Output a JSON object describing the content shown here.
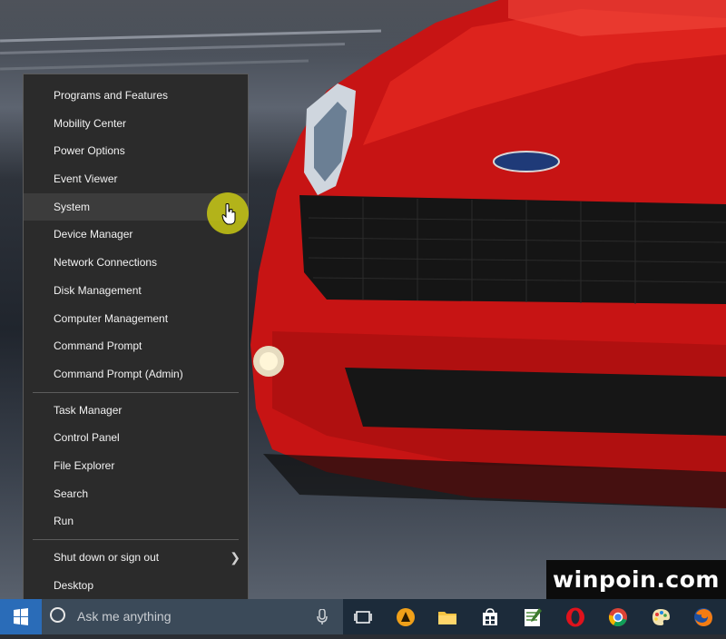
{
  "menu": {
    "group1": [
      {
        "label": "Programs and Features"
      },
      {
        "label": "Mobility Center"
      },
      {
        "label": "Power Options"
      },
      {
        "label": "Event Viewer"
      },
      {
        "label": "System"
      },
      {
        "label": "Device Manager"
      },
      {
        "label": "Network Connections"
      },
      {
        "label": "Disk Management"
      },
      {
        "label": "Computer Management"
      },
      {
        "label": "Command Prompt"
      },
      {
        "label": "Command Prompt (Admin)"
      }
    ],
    "group2": [
      {
        "label": "Task Manager"
      },
      {
        "label": "Control Panel"
      },
      {
        "label": "File Explorer"
      },
      {
        "label": "Search"
      },
      {
        "label": "Run"
      }
    ],
    "group3": [
      {
        "label": "Shut down or sign out"
      },
      {
        "label": "Desktop"
      }
    ],
    "hovered_item": "System"
  },
  "taskbar": {
    "search_placeholder": "Ask me anything",
    "pinned_icons": [
      "task-view-icon",
      "aimp-icon",
      "file-explorer-icon",
      "store-icon",
      "notepad-icon",
      "opera-icon",
      "chrome-icon",
      "paint-icon",
      "firefox-icon"
    ]
  },
  "watermark": "winpoin.com",
  "colors": {
    "menu_bg": "#2b2b2b",
    "menu_hover": "#3c3c3c",
    "taskbar_bg": "#1c2b3a",
    "start_button": "#2a6cb8",
    "car_red": "#d41a1a",
    "cursor_highlight": "#c8c814"
  }
}
